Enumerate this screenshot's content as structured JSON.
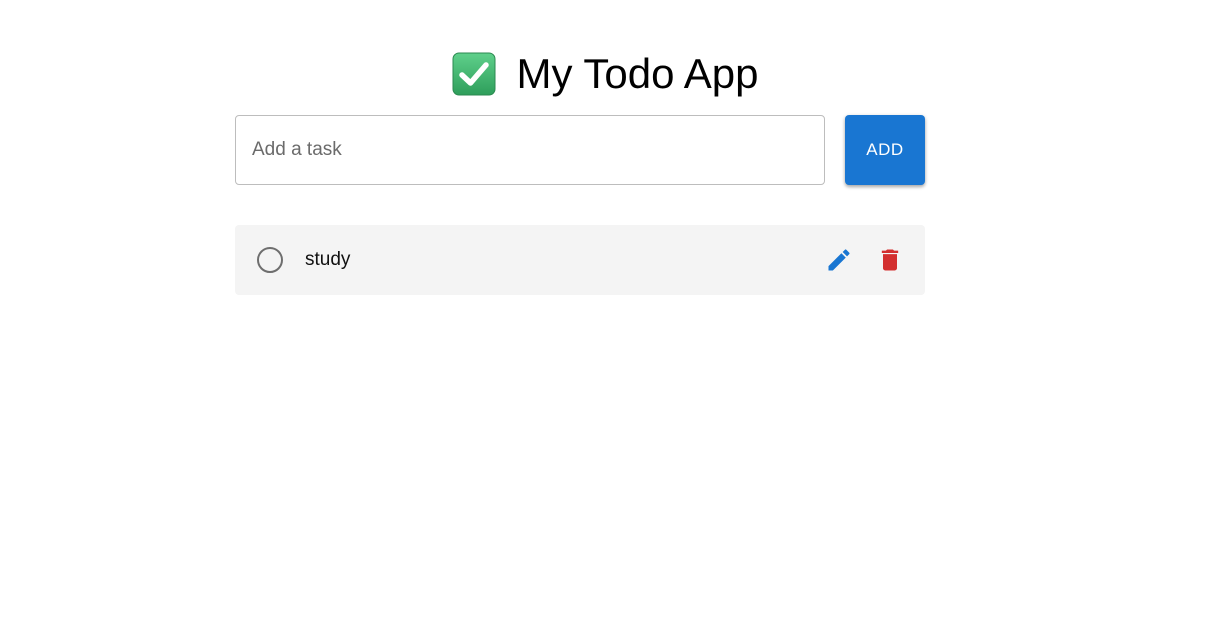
{
  "app": {
    "title": "My Todo App",
    "title_icon": "check-box-icon"
  },
  "input": {
    "placeholder": "Add a task",
    "value": ""
  },
  "add_button": {
    "label": "ADD"
  },
  "todos": [
    {
      "text": "study",
      "completed": false,
      "actions": {
        "edit_icon": "pencil-icon",
        "delete_icon": "trash-icon"
      }
    }
  ],
  "colors": {
    "primary": "#1976d2",
    "danger": "#d32f2f",
    "item_background": "#f4f4f4",
    "check_green": "#3cb371"
  }
}
